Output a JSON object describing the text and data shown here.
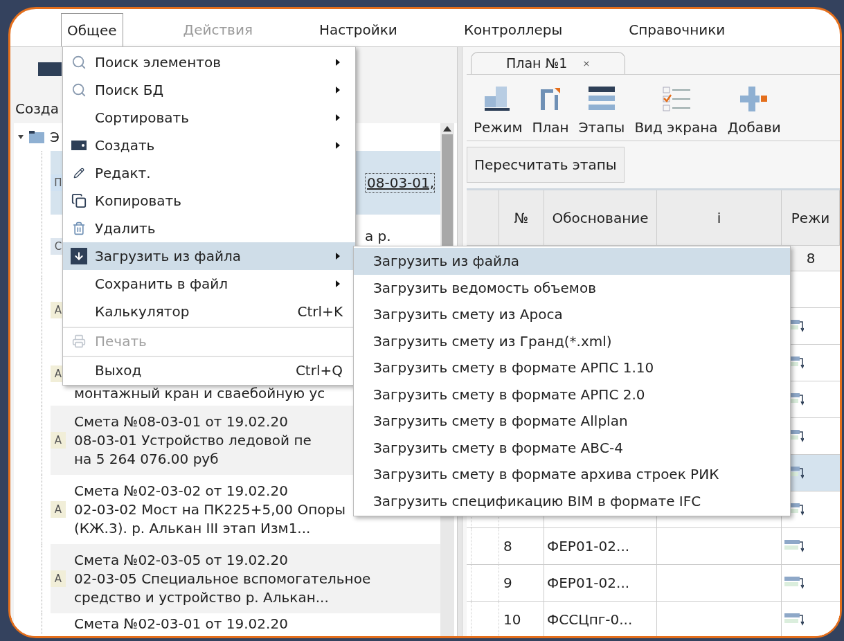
{
  "menubar": [
    {
      "label": "Общее",
      "open": true,
      "disabled": false
    },
    {
      "label": "Действия",
      "open": false,
      "disabled": true
    },
    {
      "label": "Настройки",
      "open": false,
      "disabled": false
    },
    {
      "label": "Контроллеры",
      "open": false,
      "disabled": false
    },
    {
      "label": "Справочники",
      "open": false,
      "disabled": false
    }
  ],
  "left_panel": {
    "toolbar_label": "Созда",
    "tree": {
      "root": {
        "label": "Э",
        "expanded": true
      },
      "items": [
        {
          "badge": "П",
          "color": "#cfe1f2",
          "kind": "clipped",
          "selected": true,
          "lines": [
            "08-03-01,"
          ]
        },
        {
          "badge": "С",
          "color": "#dde6ef",
          "kind": "clipped",
          "selected": false,
          "lines": [
            "а р."
          ]
        },
        {
          "badge": "А",
          "color": "#f1eed8",
          "kind": "clipped",
          "selected": false
        },
        {
          "badge": "А",
          "color": "#f1eed8",
          "kind": "tail",
          "selected": false,
          "lines": [
            "монтажный кран и сваебойную ус"
          ]
        },
        {
          "badge": "А",
          "color": "#f1eed8",
          "kind": "full",
          "selected": false,
          "lines": [
            "Смета №08-03-01 от 19.02.20",
            "08-03-01 Устройство ледовой пе",
            "на 5 264 076.00 руб"
          ]
        },
        {
          "badge": "А",
          "color": "#f1eed8",
          "kind": "full",
          "selected": false,
          "lines": [
            "Смета №02-03-02 от 19.02.20",
            "02-03-02 Мост на ПК225+5,00  Опоры",
            "(КЖ.3). р. Алькан III этап Изм1..."
          ]
        },
        {
          "badge": "А",
          "color": "#f1eed8",
          "kind": "full",
          "selected": false,
          "lines": [
            "Смета №02-03-05 от 19.02.20",
            "02-03-05 Специальное вспомогательное",
            "средство и устройство р. Алькан..."
          ]
        },
        {
          "kind": "bare",
          "selected": false,
          "lines": [
            "Смета №02-03-01 от 19.02.20"
          ]
        }
      ]
    }
  },
  "menu": {
    "items": [
      {
        "label": "Поиск элементов",
        "submenu": true,
        "selected": false,
        "disabled": false,
        "separator_before": false
      },
      {
        "label": "Поиск БД",
        "submenu": true,
        "selected": false,
        "disabled": false,
        "separator_before": false
      },
      {
        "label": "Сортировать",
        "submenu": true,
        "selected": false,
        "disabled": false,
        "separator_before": false
      },
      {
        "label": "Создать",
        "submenu": true,
        "selected": false,
        "disabled": false,
        "separator_before": false
      },
      {
        "label": "Редакт.",
        "submenu": false,
        "selected": false,
        "disabled": false,
        "separator_before": false
      },
      {
        "label": "Копировать",
        "submenu": false,
        "selected": false,
        "disabled": false,
        "separator_before": false
      },
      {
        "label": "Удалить",
        "submenu": false,
        "selected": false,
        "disabled": false,
        "separator_before": false
      },
      {
        "label": "Загрузить из файла",
        "submenu": true,
        "selected": true,
        "disabled": false,
        "separator_before": false
      },
      {
        "label": "Сохранить в файл",
        "submenu": true,
        "selected": false,
        "disabled": false,
        "separator_before": false
      },
      {
        "label": "Калькулятор",
        "shortcut": "Ctrl+K",
        "submenu": false,
        "selected": false,
        "disabled": false,
        "separator_before": false
      },
      {
        "label": "Печать",
        "submenu": false,
        "selected": false,
        "disabled": true,
        "separator_before": true
      },
      {
        "label": "Выход",
        "shortcut": "Ctrl+Q",
        "submenu": false,
        "selected": false,
        "disabled": false,
        "separator_before": true
      }
    ]
  },
  "submenu": {
    "items": [
      {
        "label": "Загрузить из файла",
        "selected": true
      },
      {
        "label": "Загрузить ведомость объемов",
        "selected": false
      },
      {
        "label": "Загрузить смету из Ароса",
        "selected": false
      },
      {
        "label": "Загрузить смету из Гранд(*.xml)",
        "selected": false
      },
      {
        "label": "Загрузить смету в формате АРПС 1.10",
        "selected": false
      },
      {
        "label": "Загрузить смету в формате АРПС 2.0",
        "selected": false
      },
      {
        "label": "Загрузить смету в формате Allplan",
        "selected": false
      },
      {
        "label": "Загрузить смету в формате АВС-4",
        "selected": false
      },
      {
        "label": "Загрузить смету в формате архива строек РИК",
        "selected": false
      },
      {
        "label": "Загрузить спецификацию BIM в формате IFC",
        "selected": false
      }
    ]
  },
  "right_panel": {
    "tab": {
      "label": "План №1",
      "close": "×",
      "selected": true
    },
    "toolbar": [
      "Режим",
      "План",
      "Этапы",
      "Вид экрана",
      "Добави"
    ],
    "recalc_button": "Пересчитать этапы",
    "table": {
      "columns": [
        "№",
        "Обоснование",
        "i",
        "Режи"
      ],
      "number_row_last": "8",
      "rows": [
        {
          "selected": false,
          "gantt": false
        },
        {
          "selected": false,
          "gantt": true
        },
        {
          "selected": false,
          "gantt": true
        },
        {
          "selected": false,
          "gantt": true
        },
        {
          "selected": false,
          "gantt": true
        },
        {
          "selected": true,
          "gantt": true
        },
        {
          "selected": false,
          "gantt": true
        },
        {
          "number": "8",
          "basis": "ФЕР01-02...",
          "selected": false,
          "gantt": true
        },
        {
          "number": "9",
          "basis": "ФЕР01-02...",
          "selected": false,
          "gantt": true
        },
        {
          "number": "10",
          "basis": "ФССЦпг-0...",
          "selected": false,
          "gantt": true
        }
      ]
    }
  }
}
